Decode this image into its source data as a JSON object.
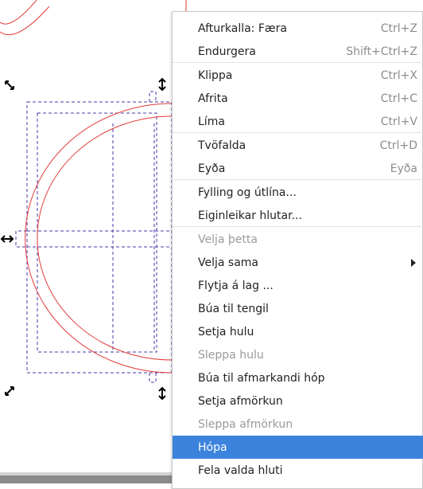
{
  "context_menu": {
    "items": [
      {
        "label": "Afturkalla: Færa",
        "accel": "Ctrl+Z"
      },
      {
        "label": "Endurgera",
        "accel": "Shift+Ctrl+Z"
      },
      {
        "label": "Klippa",
        "accel": "Ctrl+X"
      },
      {
        "label": "Afrita",
        "accel": "Ctrl+C"
      },
      {
        "label": "Líma",
        "accel": "Ctrl+V"
      },
      {
        "label": "Tvöfalda",
        "accel": "Ctrl+D"
      },
      {
        "label": "Eyða",
        "accel": "Eyða"
      },
      {
        "label": "Fylling og útlína...",
        "accel": ""
      },
      {
        "label": "Eiginleikar hlutar...",
        "accel": ""
      },
      {
        "label": "Velja þetta",
        "accel": ""
      },
      {
        "label": "Velja sama",
        "accel": ""
      },
      {
        "label": "Flytja á lag ...",
        "accel": ""
      },
      {
        "label": "Búa til tengil",
        "accel": ""
      },
      {
        "label": "Setja hulu",
        "accel": ""
      },
      {
        "label": "Sleppa hulu",
        "accel": ""
      },
      {
        "label": "Búa til afmarkandi hóp",
        "accel": ""
      },
      {
        "label": "Setja afmörkun",
        "accel": ""
      },
      {
        "label": "Sleppa afmörkun",
        "accel": ""
      },
      {
        "label": "Hópa",
        "accel": ""
      },
      {
        "label": "Fela valda hluti",
        "accel": ""
      }
    ]
  },
  "colors": {
    "highlight": "#3b83dd",
    "path_stroke": "#e23b3b",
    "bbox_dash": "#4a3aa8"
  },
  "icons": {
    "submenu_arrow": "triangle-right-icon",
    "scale_handle": "diagonal-arrows-icon",
    "stretch_handle": "double-arrow-icon"
  }
}
